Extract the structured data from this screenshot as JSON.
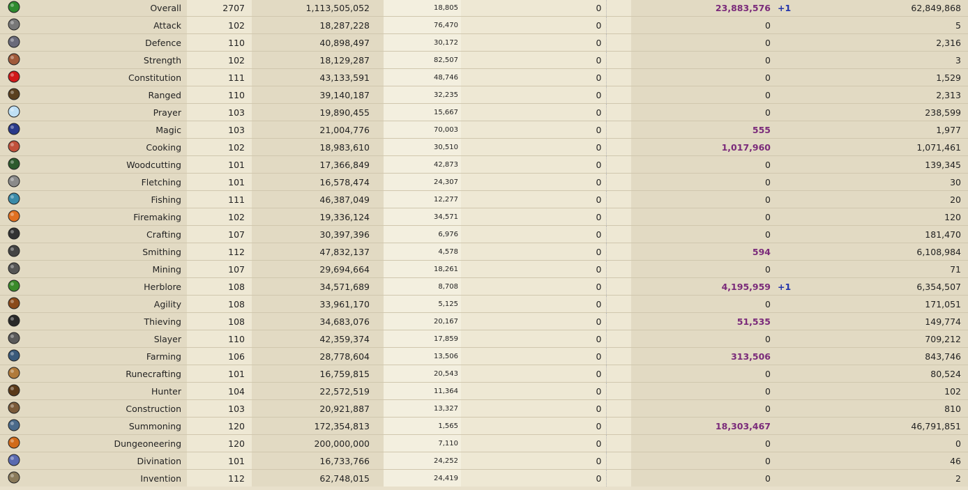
{
  "skills": [
    {
      "icon": "overall-icon",
      "name": "Overall",
      "level": "2707",
      "xp": "1,113,505,052",
      "rank": "18,805",
      "col4": "0",
      "today": "23,883,576",
      "today_hl": true,
      "plus": "+1",
      "total": "62,849,868",
      "color": "#2e8a2e"
    },
    {
      "icon": "attack-icon",
      "name": "Attack",
      "level": "102",
      "xp": "18,287,228",
      "rank": "76,470",
      "col4": "0",
      "today": "0",
      "today_hl": false,
      "plus": "",
      "total": "5",
      "color": "#777"
    },
    {
      "icon": "defence-icon",
      "name": "Defence",
      "level": "110",
      "xp": "40,898,497",
      "rank": "30,172",
      "col4": "0",
      "today": "0",
      "today_hl": false,
      "plus": "",
      "total": "2,316",
      "color": "#6a6a7a"
    },
    {
      "icon": "strength-icon",
      "name": "Strength",
      "level": "102",
      "xp": "18,129,287",
      "rank": "82,507",
      "col4": "0",
      "today": "0",
      "today_hl": false,
      "plus": "",
      "total": "3",
      "color": "#a05a3a"
    },
    {
      "icon": "constitution-icon",
      "name": "Constitution",
      "level": "111",
      "xp": "43,133,591",
      "rank": "48,746",
      "col4": "0",
      "today": "0",
      "today_hl": false,
      "plus": "",
      "total": "1,529",
      "color": "#d01818"
    },
    {
      "icon": "ranged-icon",
      "name": "Ranged",
      "level": "110",
      "xp": "39,140,187",
      "rank": "32,235",
      "col4": "0",
      "today": "0",
      "today_hl": false,
      "plus": "",
      "total": "2,313",
      "color": "#5a4020"
    },
    {
      "icon": "prayer-icon",
      "name": "Prayer",
      "level": "103",
      "xp": "19,890,455",
      "rank": "15,667",
      "col4": "0",
      "today": "0",
      "today_hl": false,
      "plus": "",
      "total": "238,599",
      "color": "#bfe0f5"
    },
    {
      "icon": "magic-icon",
      "name": "Magic",
      "level": "103",
      "xp": "21,004,776",
      "rank": "70,003",
      "col4": "0",
      "today": "555",
      "today_hl": true,
      "plus": "",
      "total": "1,977",
      "color": "#2a3a8a"
    },
    {
      "icon": "cooking-icon",
      "name": "Cooking",
      "level": "102",
      "xp": "18,983,610",
      "rank": "30,510",
      "col4": "0",
      "today": "1,017,960",
      "today_hl": true,
      "plus": "",
      "total": "1,071,461",
      "color": "#c0503a"
    },
    {
      "icon": "woodcutting-icon",
      "name": "Woodcutting",
      "level": "101",
      "xp": "17,366,849",
      "rank": "42,873",
      "col4": "0",
      "today": "0",
      "today_hl": false,
      "plus": "",
      "total": "139,345",
      "color": "#2d5a2d"
    },
    {
      "icon": "fletching-icon",
      "name": "Fletching",
      "level": "101",
      "xp": "16,578,474",
      "rank": "24,307",
      "col4": "0",
      "today": "0",
      "today_hl": false,
      "plus": "",
      "total": "30",
      "color": "#8a8a8a"
    },
    {
      "icon": "fishing-icon",
      "name": "Fishing",
      "level": "111",
      "xp": "46,387,049",
      "rank": "12,277",
      "col4": "0",
      "today": "0",
      "today_hl": false,
      "plus": "",
      "total": "20",
      "color": "#3a8aa8"
    },
    {
      "icon": "firemaking-icon",
      "name": "Firemaking",
      "level": "102",
      "xp": "19,336,124",
      "rank": "34,571",
      "col4": "0",
      "today": "0",
      "today_hl": false,
      "plus": "",
      "total": "120",
      "color": "#e07020"
    },
    {
      "icon": "crafting-icon",
      "name": "Crafting",
      "level": "107",
      "xp": "30,397,396",
      "rank": "6,976",
      "col4": "0",
      "today": "0",
      "today_hl": false,
      "plus": "",
      "total": "181,470",
      "color": "#333"
    },
    {
      "icon": "smithing-icon",
      "name": "Smithing",
      "level": "112",
      "xp": "47,832,137",
      "rank": "4,578",
      "col4": "0",
      "today": "594",
      "today_hl": true,
      "plus": "",
      "total": "6,108,984",
      "color": "#444"
    },
    {
      "icon": "mining-icon",
      "name": "Mining",
      "level": "107",
      "xp": "29,694,664",
      "rank": "18,261",
      "col4": "0",
      "today": "0",
      "today_hl": false,
      "plus": "",
      "total": "71",
      "color": "#555"
    },
    {
      "icon": "herblore-icon",
      "name": "Herblore",
      "level": "108",
      "xp": "34,571,689",
      "rank": "8,708",
      "col4": "0",
      "today": "4,195,959",
      "today_hl": true,
      "plus": "+1",
      "total": "6,354,507",
      "color": "#3a8a2a"
    },
    {
      "icon": "agility-icon",
      "name": "Agility",
      "level": "108",
      "xp": "33,961,170",
      "rank": "5,125",
      "col4": "0",
      "today": "0",
      "today_hl": false,
      "plus": "",
      "total": "171,051",
      "color": "#8a4a1a"
    },
    {
      "icon": "thieving-icon",
      "name": "Thieving",
      "level": "108",
      "xp": "34,683,076",
      "rank": "20,167",
      "col4": "0",
      "today": "51,535",
      "today_hl": true,
      "plus": "",
      "total": "149,774",
      "color": "#2a2a2a"
    },
    {
      "icon": "slayer-icon",
      "name": "Slayer",
      "level": "110",
      "xp": "42,359,374",
      "rank": "17,859",
      "col4": "0",
      "today": "0",
      "today_hl": false,
      "plus": "",
      "total": "709,212",
      "color": "#5a5a5a"
    },
    {
      "icon": "farming-icon",
      "name": "Farming",
      "level": "106",
      "xp": "28,778,604",
      "rank": "13,506",
      "col4": "0",
      "today": "313,506",
      "today_hl": true,
      "plus": "",
      "total": "843,746",
      "color": "#3a5a7a"
    },
    {
      "icon": "runecrafting-icon",
      "name": "Runecrafting",
      "level": "101",
      "xp": "16,759,815",
      "rank": "20,543",
      "col4": "0",
      "today": "0",
      "today_hl": false,
      "plus": "",
      "total": "80,524",
      "color": "#b07a3a"
    },
    {
      "icon": "hunter-icon",
      "name": "Hunter",
      "level": "104",
      "xp": "22,572,519",
      "rank": "11,364",
      "col4": "0",
      "today": "0",
      "today_hl": false,
      "plus": "",
      "total": "102",
      "color": "#5a3a1a"
    },
    {
      "icon": "construction-icon",
      "name": "Construction",
      "level": "103",
      "xp": "20,921,887",
      "rank": "13,327",
      "col4": "0",
      "today": "0",
      "today_hl": false,
      "plus": "",
      "total": "810",
      "color": "#7a5a3a"
    },
    {
      "icon": "summoning-icon",
      "name": "Summoning",
      "level": "120",
      "xp": "172,354,813",
      "rank": "1,565",
      "col4": "0",
      "today": "18,303,467",
      "today_hl": true,
      "plus": "",
      "total": "46,791,851",
      "color": "#4a6a8a"
    },
    {
      "icon": "dungeoneering-icon",
      "name": "Dungeoneering",
      "level": "120",
      "xp": "200,000,000",
      "rank": "7,110",
      "col4": "0",
      "today": "0",
      "today_hl": false,
      "plus": "",
      "total": "0",
      "color": "#d06a1a"
    },
    {
      "icon": "divination-icon",
      "name": "Divination",
      "level": "101",
      "xp": "16,733,766",
      "rank": "24,252",
      "col4": "0",
      "today": "0",
      "today_hl": false,
      "plus": "",
      "total": "46",
      "color": "#5a6ab0"
    },
    {
      "icon": "invention-icon",
      "name": "Invention",
      "level": "112",
      "xp": "62,748,015",
      "rank": "24,419",
      "col4": "0",
      "today": "0",
      "today_hl": false,
      "plus": "",
      "total": "2",
      "color": "#8a7a5a"
    }
  ]
}
